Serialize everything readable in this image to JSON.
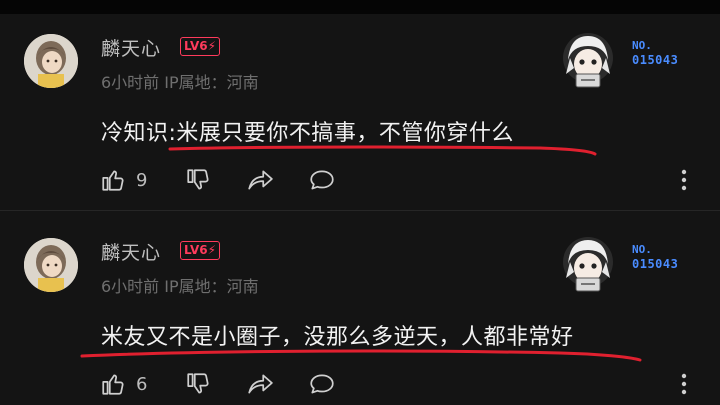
{
  "comments": [
    {
      "username": "麟天心",
      "level_badge": "LV6⚡",
      "time": "6小时前",
      "ip_location": "IP属地：河南",
      "text": "冷知识:米展只要你不搞事，不管你穿什么",
      "likes": "9",
      "fan_no_label": "NO.",
      "fan_no_value": "015043",
      "underline_color": "#e0202f"
    },
    {
      "username": "麟天心",
      "level_badge": "LV6⚡",
      "time": "6小时前",
      "ip_location": "IP属地：河南",
      "text": "米友又不是小圈子，没那么多逆天，人都非常好",
      "likes": "6",
      "fan_no_label": "NO.",
      "fan_no_value": "015043",
      "underline_color": "#e0202f"
    }
  ],
  "colors": {
    "background": "#141414",
    "level_badge": "#ff3b5c",
    "fan_number": "#4a8cff"
  },
  "icons": {
    "like": "thumbs-up-icon",
    "dislike": "thumbs-down-icon",
    "share": "share-icon",
    "reply": "comment-icon",
    "more": "more-vertical-icon"
  }
}
